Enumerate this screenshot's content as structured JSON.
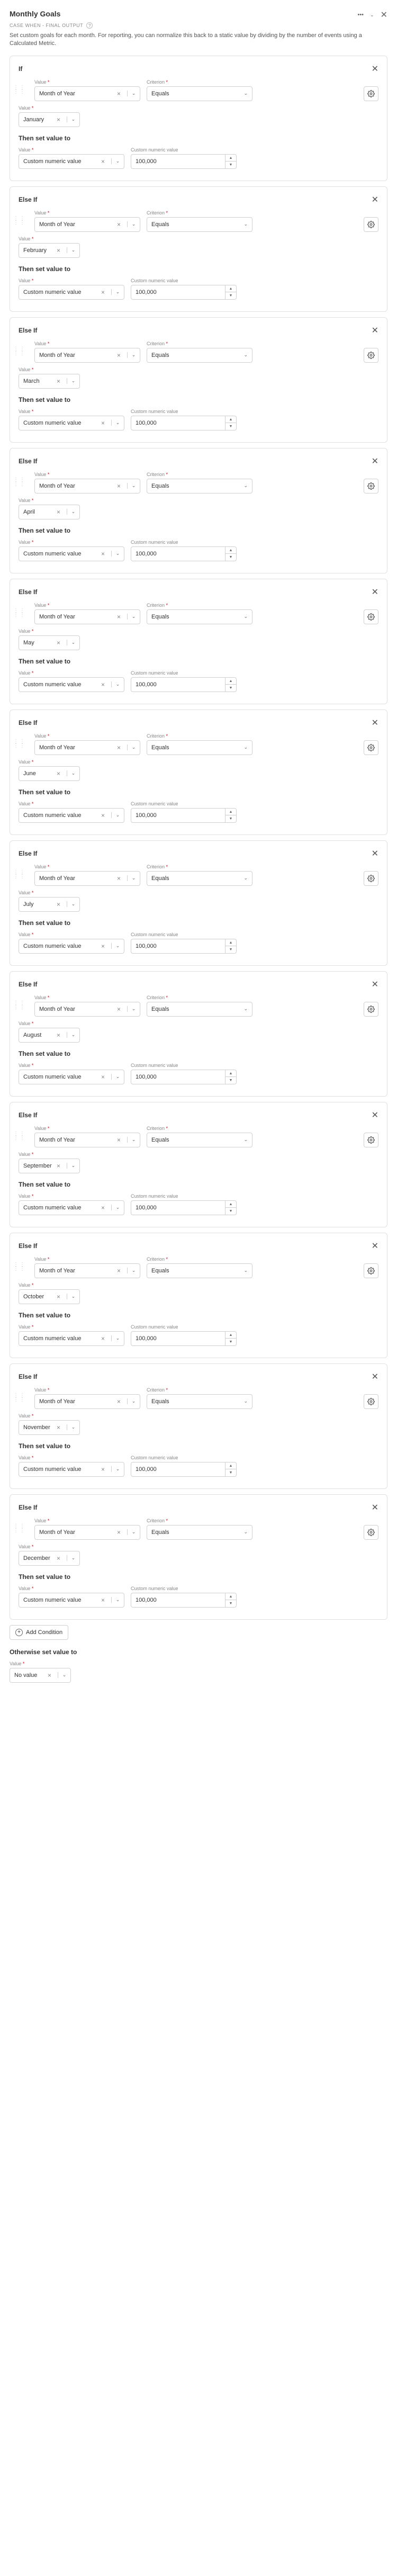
{
  "header": {
    "title": "Monthly Goals",
    "subtitle": "CASE WHEN - FINAL OUTPUT",
    "description": "Set custom goals for each month. For reporting, you can normalize this back to a static value by dividing by the number of events using a Calculated Metric."
  },
  "labels": {
    "value_label": "Value",
    "criterion_label": "Criterion",
    "then_set": "Then set value to",
    "custom_numeric": "Custom numeric value",
    "month_of_year": "Month of Year",
    "equals": "Equals",
    "if": "If",
    "else_if": "Else If",
    "add_condition": "Add Condition",
    "otherwise": "Otherwise set value to",
    "no_value": "No value"
  },
  "conditions": [
    {
      "type": "If",
      "month": "January",
      "goal": "100,000"
    },
    {
      "type": "Else If",
      "month": "February",
      "goal": "100,000"
    },
    {
      "type": "Else If",
      "month": "March",
      "goal": "100,000"
    },
    {
      "type": "Else If",
      "month": "April",
      "goal": "100,000"
    },
    {
      "type": "Else If",
      "month": "May",
      "goal": "100,000"
    },
    {
      "type": "Else If",
      "month": "June",
      "goal": "100,000"
    },
    {
      "type": "Else If",
      "month": "July",
      "goal": "100,000"
    },
    {
      "type": "Else If",
      "month": "August",
      "goal": "100,000"
    },
    {
      "type": "Else If",
      "month": "September",
      "goal": "100,000"
    },
    {
      "type": "Else If",
      "month": "October",
      "goal": "100,000"
    },
    {
      "type": "Else If",
      "month": "November",
      "goal": "100,000"
    },
    {
      "type": "Else If",
      "month": "December",
      "goal": "100,000"
    }
  ]
}
